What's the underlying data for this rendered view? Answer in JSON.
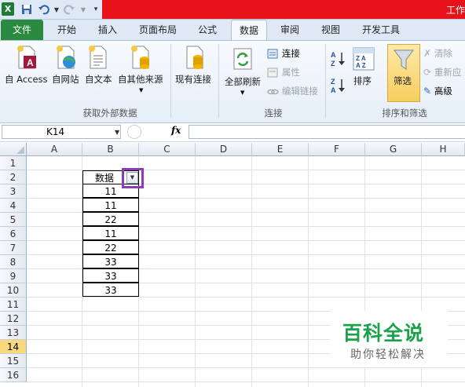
{
  "title_bar": {
    "title": "工作"
  },
  "quick_access": {
    "save_icon": "save-icon",
    "undo_icon": "undo-icon",
    "redo_icon": "redo-icon",
    "customize_icon": "customize-icon"
  },
  "tabs": [
    {
      "label": "文件"
    },
    {
      "label": "开始"
    },
    {
      "label": "插入"
    },
    {
      "label": "页面布局"
    },
    {
      "label": "公式"
    },
    {
      "label": "数据"
    },
    {
      "label": "审阅"
    },
    {
      "label": "视图"
    },
    {
      "label": "开发工具"
    }
  ],
  "active_tab": "数据",
  "ribbon": {
    "external_data": {
      "title": "获取外部数据",
      "buttons": [
        {
          "label": "自 Access",
          "icon": "access-icon"
        },
        {
          "label": "自网站",
          "icon": "web-icon"
        },
        {
          "label": "自文本",
          "icon": "text-file-icon"
        },
        {
          "label": "自其他来源",
          "icon": "other-sources-icon"
        }
      ],
      "existing": {
        "label": "现有连接",
        "icon": "existing-connections-icon"
      }
    },
    "connections": {
      "title": "连接",
      "refresh_all": "全部刷新",
      "items": [
        {
          "label": "连接",
          "enabled": true
        },
        {
          "label": "属性",
          "enabled": false
        },
        {
          "label": "编辑链接",
          "enabled": false
        }
      ]
    },
    "sort_filter": {
      "title": "排序和筛选",
      "sort": "排序",
      "filter": "筛选",
      "items": [
        {
          "label": "清除",
          "enabled": false
        },
        {
          "label": "重新应",
          "enabled": false
        },
        {
          "label": "高级",
          "enabled": true
        }
      ]
    }
  },
  "formula_bar": {
    "name_box": "K14",
    "fx_label": "fx",
    "formula": ""
  },
  "sheet": {
    "columns": [
      "A",
      "B",
      "C",
      "D",
      "E",
      "F",
      "G",
      "H"
    ],
    "rows": [
      "1",
      "2",
      "3",
      "4",
      "5",
      "6",
      "7",
      "8",
      "9",
      "10",
      "11",
      "12",
      "13",
      "14",
      "15",
      "16"
    ],
    "selected_row": "14",
    "header_cell": "数据",
    "values": [
      "11",
      "11",
      "22",
      "11",
      "22",
      "33",
      "33",
      "33"
    ]
  },
  "watermark": {
    "line1": "百科全说",
    "line2": "助你轻松解决"
  },
  "colors": {
    "title_red": "#e8131a",
    "file_tab": "#2a8a3f",
    "highlight": "#8b3ab8",
    "selected_row": "#f9d97c",
    "watermark": "#19a24a"
  }
}
